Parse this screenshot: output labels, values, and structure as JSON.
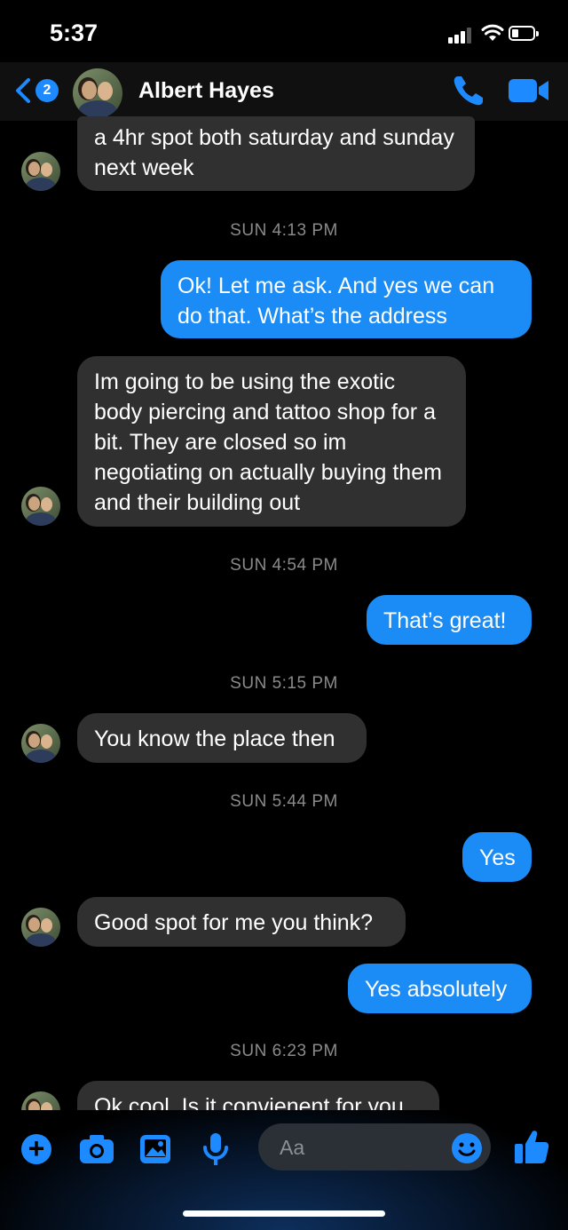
{
  "status": {
    "time": "5:37"
  },
  "header": {
    "back_badge": "2",
    "contact_name": "Albert Hayes"
  },
  "messages": [
    {
      "type": "in",
      "text": "a 4hr spot both saturday and sunday next week"
    },
    {
      "type": "time",
      "text": "SUN 4:13 PM"
    },
    {
      "type": "out",
      "text": "Ok! Let me ask. And yes we can do that. What’s the address"
    },
    {
      "type": "in",
      "text": "Im going to be using the exotic body piercing and tattoo shop for a bit. They are closed so im negotiating on actually buying them and their building out"
    },
    {
      "type": "time",
      "text": "SUN 4:54 PM"
    },
    {
      "type": "out",
      "text": "That’s great!"
    },
    {
      "type": "time",
      "text": "SUN 5:15 PM"
    },
    {
      "type": "in",
      "text": "You know the place then"
    },
    {
      "type": "time",
      "text": "SUN 5:44 PM"
    },
    {
      "type": "out",
      "text": "Yes"
    },
    {
      "type": "in",
      "text": "Good spot for me you think?"
    },
    {
      "type": "out",
      "text": "Yes absolutely"
    },
    {
      "type": "time",
      "text": "SUN 6:23 PM"
    },
    {
      "type": "in",
      "text": "Ok cool. Is it convienent for you"
    }
  ],
  "composer": {
    "placeholder": "Aa"
  },
  "colors": {
    "accent": "#1d8bff",
    "incoming_bubble": "#303030",
    "outgoing_bubble": "#1b8cf5"
  },
  "icons": [
    "back-chevron-icon",
    "phone-icon",
    "video-camera-icon",
    "plus-icon",
    "camera-icon",
    "photo-icon",
    "microphone-icon",
    "emoji-icon",
    "thumbs-up-icon"
  ]
}
